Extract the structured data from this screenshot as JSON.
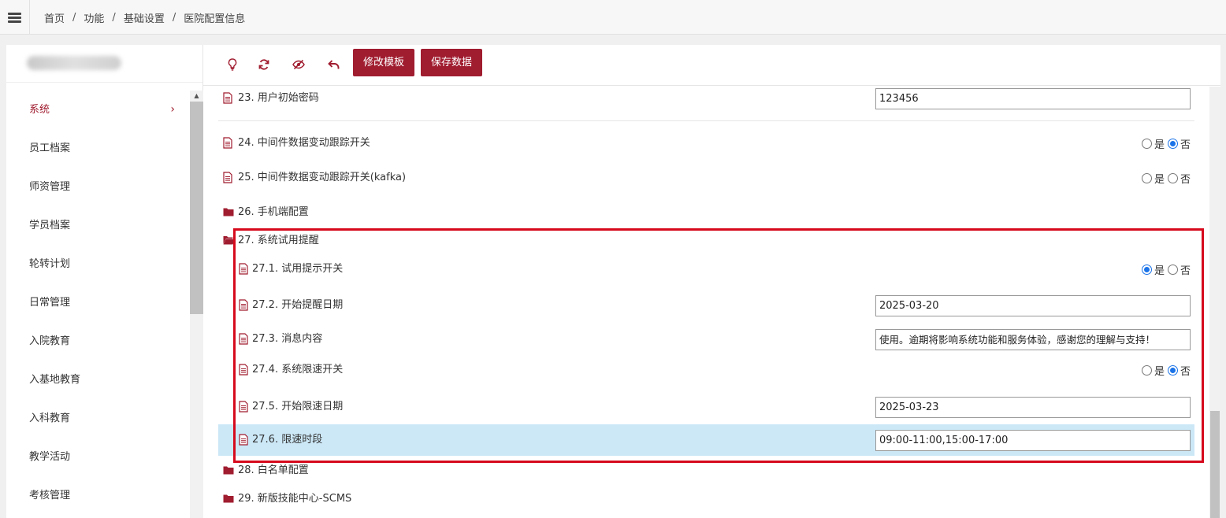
{
  "breadcrumb": [
    "首页",
    "功能",
    "基础设置",
    "医院配置信息"
  ],
  "sidebar": {
    "items": [
      {
        "label": "系统",
        "active": true
      },
      {
        "label": "员工档案"
      },
      {
        "label": "师资管理"
      },
      {
        "label": "学员档案"
      },
      {
        "label": "轮转计划"
      },
      {
        "label": "日常管理"
      },
      {
        "label": "入院教育"
      },
      {
        "label": "入基地教育"
      },
      {
        "label": "入科教育"
      },
      {
        "label": "教学活动"
      },
      {
        "label": "考核管理"
      }
    ]
  },
  "toolbar": {
    "icons": [
      "lightbulb-icon",
      "refresh-icon",
      "eye-off-icon",
      "undo-icon"
    ],
    "edit_template_label": "修改模板",
    "save_data_label": "保存数据"
  },
  "config": {
    "item23": {
      "label": "23. 用户初始密码",
      "value": "123456"
    },
    "item24": {
      "label": "24. 中间件数据变动跟踪开关",
      "selected": "否"
    },
    "item25": {
      "label": "25. 中间件数据变动跟踪开关(kafka)",
      "selected": ""
    },
    "item26": {
      "label": "26. 手机端配置"
    },
    "item27": {
      "label": "27. 系统试用提醒",
      "children": {
        "c1": {
          "label": "27.1. 试用提示开关",
          "selected": "是"
        },
        "c2": {
          "label": "27.2. 开始提醒日期",
          "value": "2025-03-20"
        },
        "c3": {
          "label": "27.3. 消息内容",
          "value": "使用。逾期将影响系统功能和服务体验，感谢您的理解与支持！"
        },
        "c4": {
          "label": "27.4. 系统限速开关",
          "selected": "否"
        },
        "c5": {
          "label": "27.5. 开始限速日期",
          "value": "2025-03-23"
        },
        "c6": {
          "label": "27.6. 限速时段",
          "value": "09:00-11:00,15:00-17:00"
        }
      }
    },
    "item28": {
      "label": "28. 白名单配置"
    },
    "item29": {
      "label": "29. 新版技能中心-SCMS"
    }
  },
  "radio": {
    "yes": "是",
    "no": "否"
  },
  "colors": {
    "accent": "#a01c2f",
    "highlight": "#cce8f7",
    "annotation": "#d60a1c",
    "radio_checked": "#1a73e8"
  }
}
